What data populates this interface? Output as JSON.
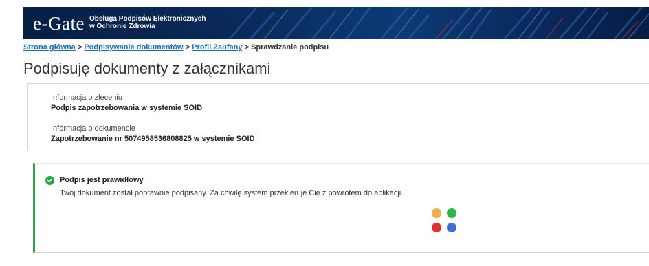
{
  "header": {
    "logo_text": "e-Gate",
    "subtitle_line1": "Obsługa Podpisów Elektronicznych",
    "subtitle_line2": "w Ochronie Zdrowia"
  },
  "breadcrumb": {
    "items": [
      "Strona główna",
      "Podpisywanie dokumentów",
      "Profil Zaufany"
    ],
    "separator": ">",
    "current": "Sprawdzanie podpisu"
  },
  "page": {
    "title": "Podpisuję dokumenty z załącznikami"
  },
  "order_info": {
    "label": "Informacja o zleceniu",
    "value": "Podpis zapotrzebowania w systemie SOID"
  },
  "document_info": {
    "label": "Informacja o dokumencie",
    "value": "Zapotrzebowanie nr 5074958536808825 w systemie SOID"
  },
  "status": {
    "icon": "check-circle-icon",
    "title": "Podpis jest prawidłowy",
    "message": "Twój dokument został poprawnie podpisany. Za chwilę system przekieruje Cię z powrotem do aplikacji.",
    "accent_color": "#28a745"
  },
  "loader": {
    "icon": "loading-dots-icon",
    "colors": [
      "#e8b14a",
      "#2db84a",
      "#e03030",
      "#3a6fd8"
    ]
  }
}
